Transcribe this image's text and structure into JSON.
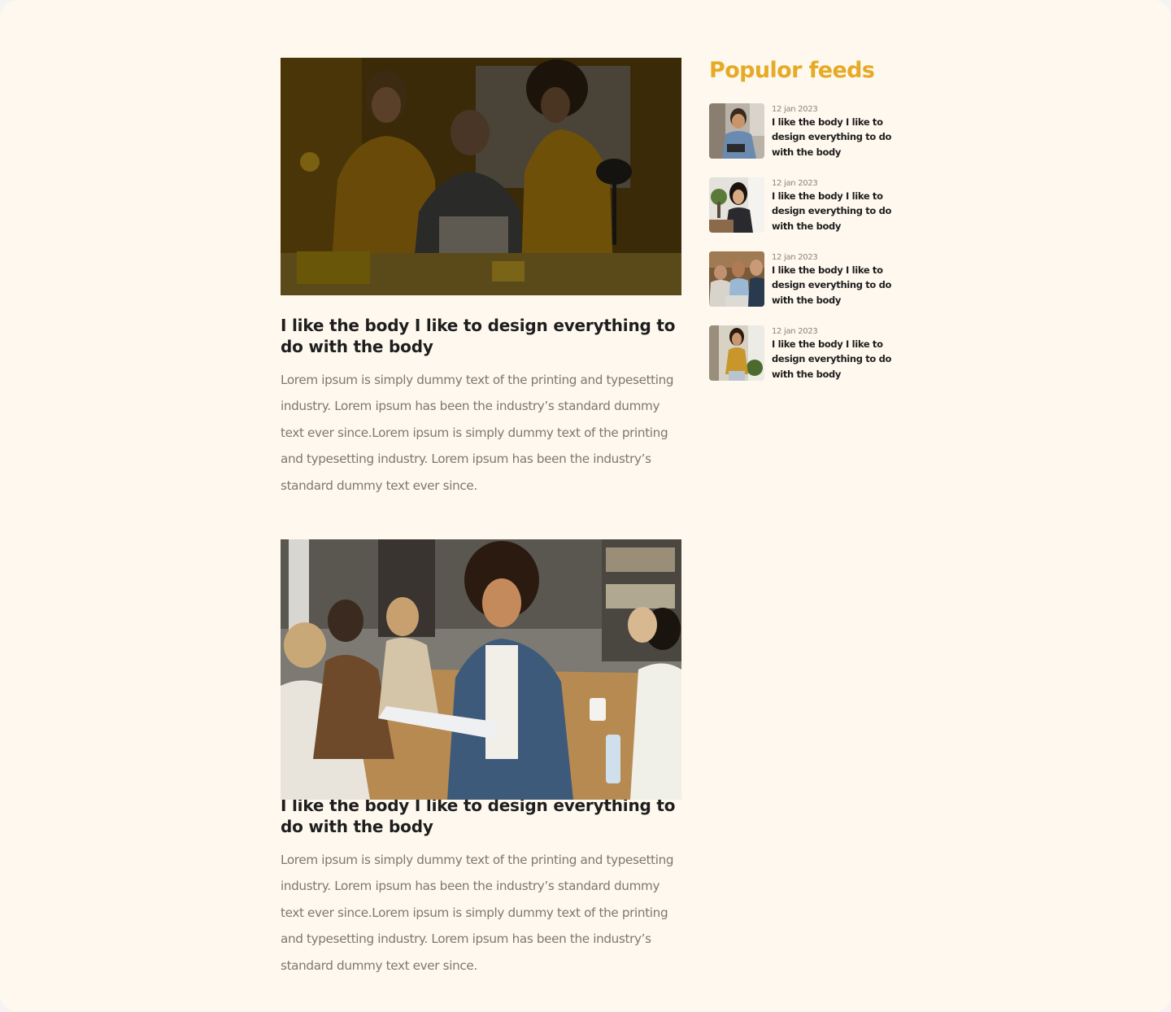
{
  "sidebar": {
    "title": "Populor feeds",
    "items": [
      {
        "date": "12 jan 2023",
        "headline": "I like the body I like to design everything to do with the body"
      },
      {
        "date": "12 jan 2023",
        "headline": "I like the body I like to design everything to do with the body"
      },
      {
        "date": "12 jan 2023",
        "headline": "I like the body I like to design everything to do with the body"
      },
      {
        "date": "12 jan 2023",
        "headline": "I like the body I like to design everything to do with the body"
      }
    ]
  },
  "articles": [
    {
      "title": "I like the body I like to design everything to do with the body",
      "body": "Lorem ipsum is simply dummy text of the printing and typesetting industry. Lorem ipsum has been the industry’s standard dummy text ever since.Lorem ipsum is simply dummy text of the printing and typesetting industry. Lorem ipsum has been the industry’s standard dummy text ever since."
    },
    {
      "title": "I like the body I like to design everything to do with the body",
      "body": "Lorem ipsum is simply dummy text of the printing and typesetting industry. Lorem ipsum has been the industry’s standard dummy text ever since.Lorem ipsum is simply dummy text of the printing and typesetting industry. Lorem ipsum has been the industry’s standard dummy text ever since."
    }
  ],
  "colors": {
    "page_background": "#fef8ee",
    "accent": "#e6aa26",
    "heading": "#1e1e1e",
    "body_text": "#7d7770"
  }
}
